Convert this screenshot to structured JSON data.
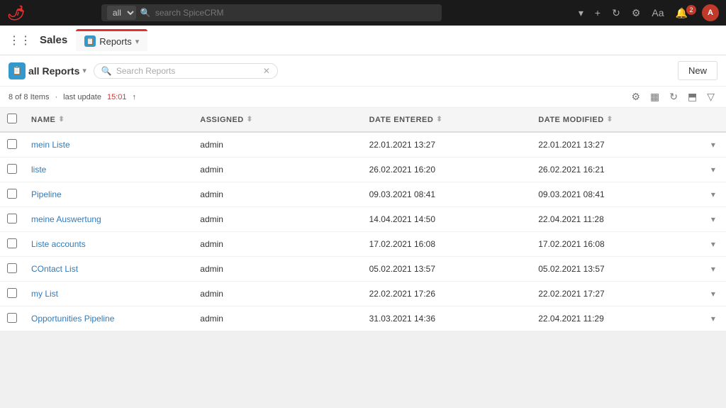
{
  "topbar": {
    "logo": "🌶",
    "search_placeholder": "search SpiceCRM",
    "select_default": "all",
    "icons": {
      "dropdown": "▾",
      "plus": "+",
      "settings": "⚙",
      "font": "A",
      "bell": "🔔",
      "notif_count": "2",
      "avatar_label": "A"
    }
  },
  "appbar": {
    "grid_icon": "⋮⋮",
    "app_title": "Sales",
    "tab_label": "Reports",
    "tab_icon": "📋"
  },
  "list_header": {
    "icon_label": "📋",
    "title": "all Reports",
    "caret": "▾",
    "search_placeholder": "Search Reports",
    "new_btn": "New"
  },
  "stats_bar": {
    "count_text": "8 of 8 Items",
    "separator": "·",
    "last_update_label": "last update",
    "last_update_time": "15:01",
    "trend_icon": "↑"
  },
  "table": {
    "columns": [
      {
        "id": "check",
        "label": ""
      },
      {
        "id": "name",
        "label": "NAME"
      },
      {
        "id": "assigned",
        "label": "ASSIGNED"
      },
      {
        "id": "date_entered",
        "label": "DATE ENTERED"
      },
      {
        "id": "date_modified",
        "label": "DATE MODIFIED"
      },
      {
        "id": "action",
        "label": ""
      }
    ],
    "rows": [
      {
        "name": "mein Liste",
        "assigned": "admin",
        "date_entered": "22.01.2021  13:27",
        "date_modified": "22.01.2021  13:27"
      },
      {
        "name": "liste",
        "assigned": "admin",
        "date_entered": "26.02.2021  16:20",
        "date_modified": "26.02.2021  16:21"
      },
      {
        "name": "Pipeline",
        "assigned": "admin",
        "date_entered": "09.03.2021  08:41",
        "date_modified": "09.03.2021  08:41"
      },
      {
        "name": "meine Auswertung",
        "assigned": "admin",
        "date_entered": "14.04.2021  14:50",
        "date_modified": "22.04.2021  11:28"
      },
      {
        "name": "Liste accounts",
        "assigned": "admin",
        "date_entered": "17.02.2021  16:08",
        "date_modified": "17.02.2021  16:08"
      },
      {
        "name": "COntact List",
        "assigned": "admin",
        "date_entered": "05.02.2021  13:57",
        "date_modified": "05.02.2021  13:57"
      },
      {
        "name": "my List",
        "assigned": "admin",
        "date_entered": "22.02.2021  17:26",
        "date_modified": "22.02.2021  17:27"
      },
      {
        "name": "Opportunities Pipeline",
        "assigned": "admin",
        "date_entered": "31.03.2021  14:36",
        "date_modified": "22.04.2021  11:29"
      }
    ]
  }
}
